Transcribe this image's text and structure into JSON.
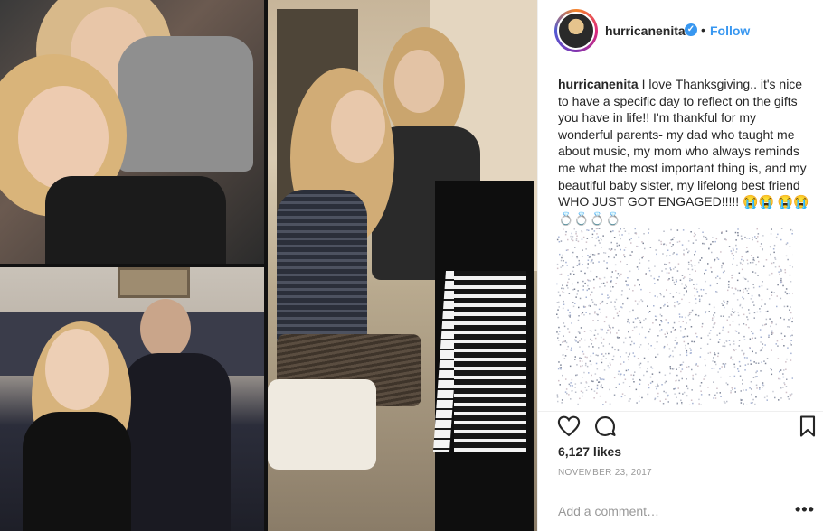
{
  "post": {
    "username": "hurricanenita",
    "follow_label": "Follow",
    "separator": "•",
    "verified_badge": "✓",
    "caption_user": "hurricanenita",
    "caption_text": " I love Thanksgiving.. it's nice to have a specific day to reflect on the gifts you have in life!! I'm thankful for my wonderful parents- my dad who taught me about music, my mom who always reminds me what the most important thing is, and my beautiful baby sister, my lifelong best friend WHO JUST GOT ENGAGED!!!!! 😭😭 😭😭💍💍💍💍",
    "likes": "6,127 likes",
    "date": "NOVEMBER 23, 2017",
    "comment_placeholder": "Add a comment…",
    "more_label": "•••"
  },
  "icons": {
    "like": "heart-icon",
    "comment": "comment-bubble-icon",
    "save": "bookmark-icon",
    "verified": "verified-badge-icon"
  },
  "colors": {
    "link_blue": "#3897f0",
    "text": "#262626",
    "muted": "#999999",
    "divider": "#efefef"
  }
}
